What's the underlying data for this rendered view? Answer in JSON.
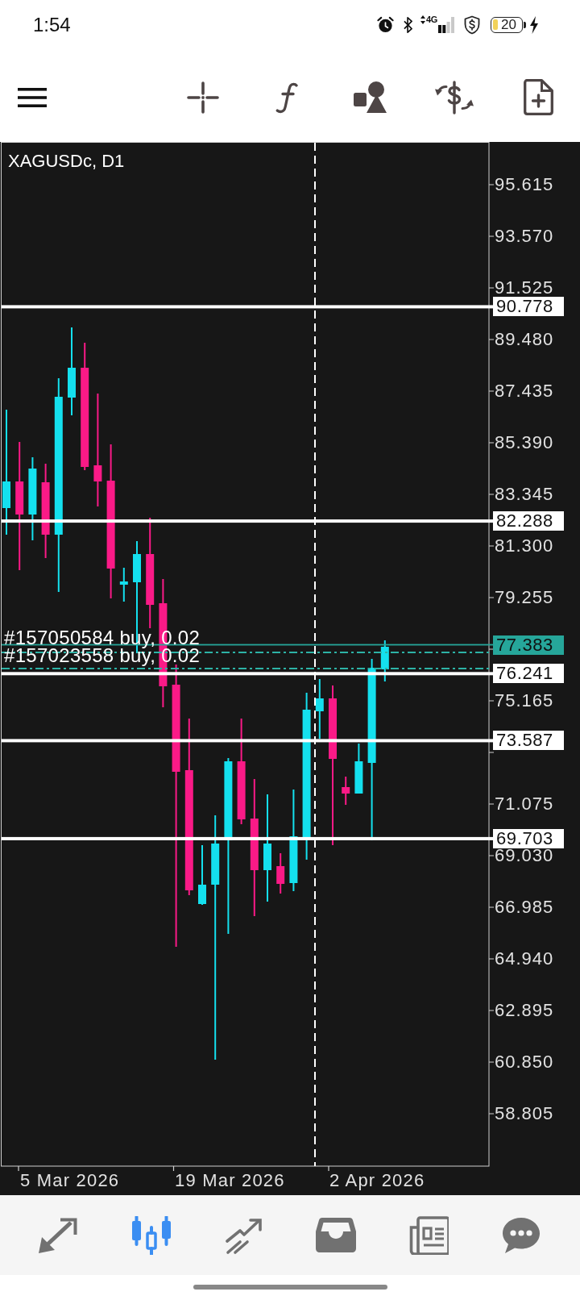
{
  "status_bar": {
    "time": "1:54",
    "network": "4G",
    "battery": "20"
  },
  "chart": {
    "symbol": "XAGUSDc, D1",
    "price_scale": [
      "95.615",
      "93.570",
      "91.525",
      "89.480",
      "87.435",
      "85.390",
      "83.345",
      "81.300",
      "79.255",
      "75.165",
      "71.075",
      "69.030",
      "66.985",
      "64.940",
      "62.895",
      "60.850",
      "58.805"
    ],
    "price_lines": [
      {
        "price": "90.778",
        "kind": "level"
      },
      {
        "price": "82.288",
        "kind": "level"
      },
      {
        "price": "77.383",
        "kind": "bid"
      },
      {
        "price": "76.241",
        "kind": "level"
      },
      {
        "price": "73.587",
        "kind": "level"
      },
      {
        "price": "69.703",
        "kind": "level"
      }
    ],
    "orders": [
      {
        "label": "#157050584 buy, 0.02"
      },
      {
        "label": "#157023558 buy, 0.02"
      }
    ],
    "dates": [
      "5 Mar 2026",
      "19 Mar 2026",
      "2 Apr 2026"
    ]
  },
  "nav_tabs": [
    {
      "selected": false
    },
    {
      "selected": true
    },
    {
      "selected": false
    },
    {
      "selected": false
    },
    {
      "selected": false
    },
    {
      "selected": false
    }
  ]
}
